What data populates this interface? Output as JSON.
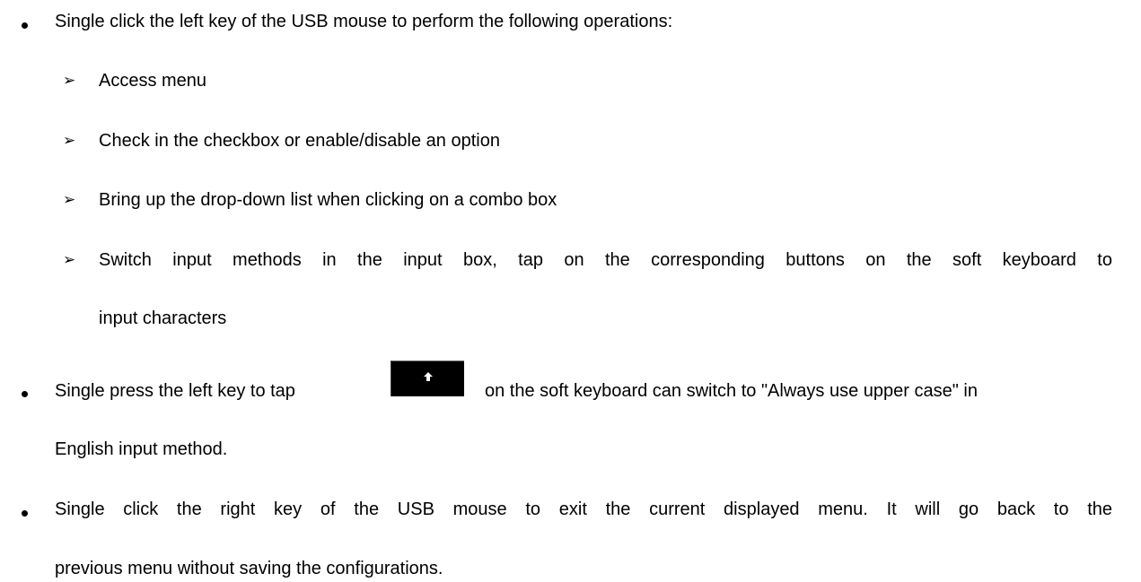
{
  "items": [
    {
      "text": "Single click the left key of the USB mouse to perform the following operations:",
      "subitems": [
        {
          "text": "Access menu"
        },
        {
          "text": "Check in the checkbox or enable/disable an option"
        },
        {
          "text": "Bring up the drop-down list when clicking on a combo box"
        },
        {
          "text": "Switch input methods in the input box, tap on the corresponding buttons on the soft keyboard to",
          "cont": "input characters"
        }
      ]
    },
    {
      "before": "Single press the left key to tap",
      "icon": "shift-key-icon",
      "after": "on the soft keyboard can switch to \"Always use upper case\" in",
      "cont": "English input method."
    },
    {
      "line1": "Single click the right key of the USB mouse to exit the current displayed menu. It will go back to the",
      "line2": "previous menu without saving the configurations."
    }
  ]
}
